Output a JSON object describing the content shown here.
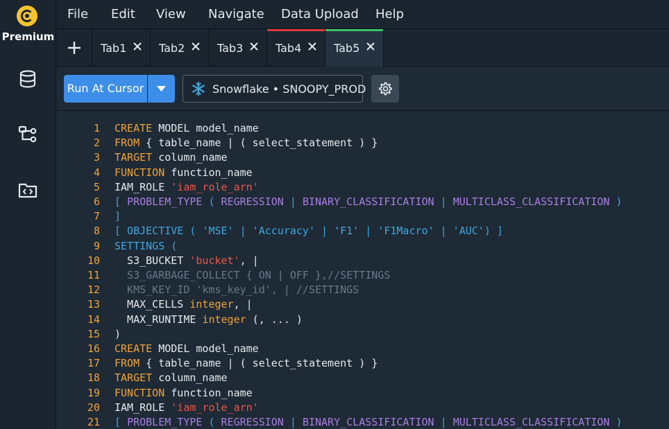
{
  "app": {
    "brand": "Premium"
  },
  "sidebar": {
    "icons": [
      "database-icon",
      "schema-tree-icon",
      "code-folder-icon"
    ]
  },
  "menu": {
    "items": [
      "File",
      "Edit",
      "View",
      "Navigate",
      "Data Upload",
      "Help"
    ]
  },
  "tabs": [
    {
      "label": "Tab1",
      "active": false,
      "indicator": ""
    },
    {
      "label": "Tab2",
      "active": false,
      "indicator": ""
    },
    {
      "label": "Tab3",
      "active": false,
      "indicator": ""
    },
    {
      "label": "Tab4",
      "active": false,
      "indicator": "#e03a3a"
    },
    {
      "label": "Tab5",
      "active": true,
      "indicator": "#3cc46a"
    }
  ],
  "toolbar": {
    "run_label": "Run At Cursor",
    "connection_label": "Snowflake • SNOOPY_PROD"
  },
  "colors": {
    "accent": "#3d8ee8",
    "keyword": "#f0a43a",
    "string": "#e8584a",
    "purple": "#a87fe0",
    "blue": "#3fa7e0",
    "comment": "#6b7785"
  },
  "editor": {
    "lines": [
      {
        "n": "1",
        "tokens": [
          [
            "kw",
            "CREATE"
          ],
          [
            "tx",
            " MODEL model_name"
          ]
        ]
      },
      {
        "n": "2",
        "tokens": [
          [
            "kw",
            "FROM"
          ],
          [
            "tx",
            " { table_name | ( select_statement ) }"
          ]
        ]
      },
      {
        "n": "3",
        "tokens": [
          [
            "kw",
            "TARGET"
          ],
          [
            "tx",
            " column_name"
          ]
        ]
      },
      {
        "n": "4",
        "tokens": [
          [
            "kw",
            "FUNCTION"
          ],
          [
            "tx",
            " function_name"
          ]
        ]
      },
      {
        "n": "5",
        "tokens": [
          [
            "tx",
            "IAM_ROLE "
          ],
          [
            "str",
            "'iam_role_arn'"
          ]
        ]
      },
      {
        "n": "6",
        "tokens": [
          [
            "blu",
            "[ "
          ],
          [
            "pur",
            "PROBLEM_TYPE"
          ],
          [
            "blu",
            " ( "
          ],
          [
            "pur",
            "REGRESSION"
          ],
          [
            "blu",
            " | "
          ],
          [
            "pur",
            "BINARY_CLASSIFICATION"
          ],
          [
            "blu",
            " | "
          ],
          [
            "pur",
            "MULTICLASS_CLASSIFICATION"
          ],
          [
            "blu",
            " )"
          ]
        ]
      },
      {
        "n": "7",
        "tokens": [
          [
            "blu",
            "]"
          ]
        ]
      },
      {
        "n": "8",
        "tokens": [
          [
            "blu",
            "[ OBJECTIVE ( 'MSE' | 'Accuracy' | 'F1' | 'F1Macro' | 'AUC') ]"
          ]
        ]
      },
      {
        "n": "9",
        "tokens": [
          [
            "blu",
            "SETTINGS ("
          ]
        ]
      },
      {
        "n": "10",
        "tokens": [
          [
            "tx",
            "  S3_BUCKET "
          ],
          [
            "str",
            "'bucket'"
          ],
          [
            "tx",
            ", |"
          ]
        ]
      },
      {
        "n": "11",
        "tokens": [
          [
            "cm",
            "  S3_GARBAGE_COLLECT { ON | OFF },//SETTINGS"
          ]
        ]
      },
      {
        "n": "12",
        "tokens": [
          [
            "cm",
            "  KMS_KEY_ID 'kms_key_id', | //SETTINGS"
          ]
        ]
      },
      {
        "n": "13",
        "tokens": [
          [
            "tx",
            "  MAX_CELLS "
          ],
          [
            "kw",
            "integer"
          ],
          [
            "tx",
            ", |"
          ]
        ]
      },
      {
        "n": "14",
        "tokens": [
          [
            "tx",
            "  MAX_RUNTIME "
          ],
          [
            "kw",
            "integer"
          ],
          [
            "tx",
            " (, ... )"
          ]
        ]
      },
      {
        "n": "15",
        "tokens": [
          [
            "tx",
            ")"
          ]
        ]
      },
      {
        "n": "16",
        "tokens": [
          [
            "kw",
            "CREATE"
          ],
          [
            "tx",
            " MODEL model_name"
          ]
        ]
      },
      {
        "n": "17",
        "tokens": [
          [
            "kw",
            "FROM"
          ],
          [
            "tx",
            " { table_name | ( select_statement ) }"
          ]
        ]
      },
      {
        "n": "18",
        "tokens": [
          [
            "kw",
            "TARGET"
          ],
          [
            "tx",
            " column_name"
          ]
        ]
      },
      {
        "n": "19",
        "tokens": [
          [
            "kw",
            "FUNCTION"
          ],
          [
            "tx",
            " function_name"
          ]
        ]
      },
      {
        "n": "20",
        "tokens": [
          [
            "tx",
            "IAM_ROLE "
          ],
          [
            "str",
            "'iam_role_arn'"
          ]
        ]
      },
      {
        "n": "21",
        "tokens": [
          [
            "blu",
            "[ "
          ],
          [
            "pur",
            "PROBLEM_TYPE"
          ],
          [
            "blu",
            " ( "
          ],
          [
            "pur",
            "REGRESSION"
          ],
          [
            "blu",
            " | "
          ],
          [
            "pur",
            "BINARY_CLASSIFICATION"
          ],
          [
            "blu",
            " | "
          ],
          [
            "pur",
            "MULTICLASS_CLASSIFICATION"
          ],
          [
            "blu",
            " )"
          ]
        ]
      }
    ]
  }
}
